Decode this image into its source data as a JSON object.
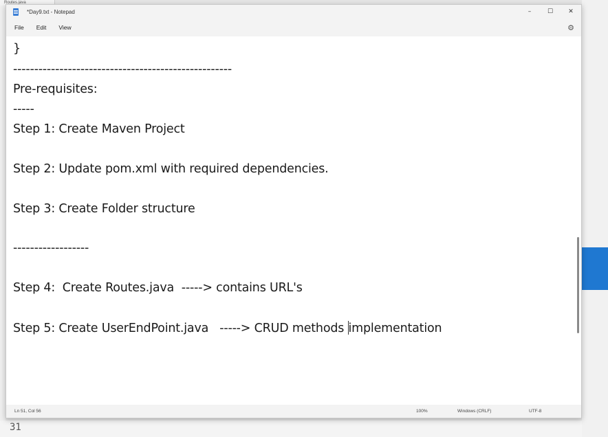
{
  "background": {
    "tab_label": "Routes.java",
    "line_number": "31"
  },
  "window": {
    "title": "*Day9.txt - Notepad",
    "controls": {
      "minimize": "–",
      "maximize": "☐",
      "close": "✕"
    }
  },
  "menu": {
    "items": [
      "File",
      "Edit",
      "View"
    ]
  },
  "editor": {
    "lines": [
      "}",
      "----------------------------------------------------",
      "Pre-requisites:",
      "-----",
      "Step 1: Create Maven Project",
      "Step 2: Update pom.xml with required dependencies.",
      "Step 3: Create Folder structure",
      "------------------",
      "Step 4:  Create Routes.java  -----> contains URL's",
      "Step 5: Create UserEndPoint.java   -----> CRUD methods ",
      "implementation"
    ]
  },
  "status": {
    "position": "Ln 51, Col 56",
    "zoom": "100%",
    "line_ending": "Windows (CRLF)",
    "encoding": "UTF-8"
  },
  "colors": {
    "accent_blue": "#1f78d1"
  }
}
